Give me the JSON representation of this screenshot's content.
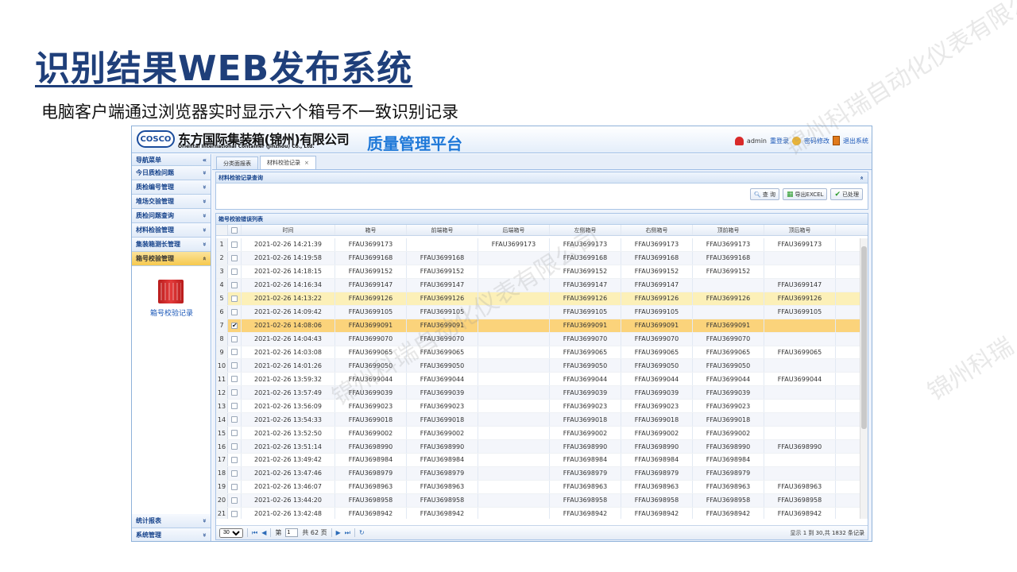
{
  "slide": {
    "title": "识别结果WEB发布系统",
    "subtitle": "电脑客户端通过浏览器实时显示六个箱号不一致识别记录",
    "watermarks": [
      "锦州科瑞自动化仪表有限公司",
      "锦州科瑞"
    ]
  },
  "app": {
    "logo": "COSCO",
    "company_cn": "东方国际集装箱(锦州)有限公司",
    "company_en": "Oriental International Container (Jinzhou) Co., Ltd.",
    "platform": "质量管理平台",
    "user": {
      "name": "admin",
      "relogin": "重登录",
      "change_password": "密码修改",
      "logout": "退出系统"
    },
    "sidebar": {
      "header": "导航菜单",
      "collapse_glyph": "«",
      "items": [
        {
          "label": "今日质检问题",
          "glyph": "»"
        },
        {
          "label": "质检编号管理",
          "glyph": "»"
        },
        {
          "label": "堆场交验管理",
          "glyph": "»"
        },
        {
          "label": "质检问题查询",
          "glyph": "»"
        },
        {
          "label": "材料检验管理",
          "glyph": "»"
        },
        {
          "label": "集装箱测长管理",
          "glyph": "»"
        },
        {
          "label": "箱号校验管理",
          "glyph": "«"
        }
      ],
      "panel_item": "箱号校验记录",
      "bottom_items": [
        {
          "label": "统计报表",
          "glyph": "»"
        },
        {
          "label": "系统管理",
          "glyph": "»"
        }
      ]
    },
    "tabs": [
      {
        "label": "分类面报表"
      },
      {
        "label": "材料校验记录",
        "close": "×"
      }
    ],
    "query_panel": {
      "title": "材料检验记录查询",
      "collapse_glyph": "«",
      "buttons": {
        "query": "查 询",
        "export": "导出EXCEL",
        "processed": "已处理"
      }
    },
    "grid": {
      "title": "箱号校验错误列表",
      "columns": [
        "时间",
        "箱号",
        "前端箱号",
        "后端箱号",
        "左侧箱号",
        "右侧箱号",
        "顶前箱号",
        "顶后箱号"
      ],
      "rows": [
        {
          "n": "1",
          "checked": false,
          "time": "2021-02-26 14:21:39",
          "no": "FFAU3699173",
          "front": "",
          "rear": "FFAU3699173",
          "left": "FFAU3699173",
          "right": "FFAU3699173",
          "top": "FFAU3699173",
          "topr": "FFAU3699173"
        },
        {
          "n": "2",
          "checked": false,
          "time": "2021-02-26 14:19:58",
          "no": "FFAU3699168",
          "front": "FFAU3699168",
          "rear": "",
          "left": "FFAU3699168",
          "right": "FFAU3699168",
          "top": "FFAU3699168",
          "topr": ""
        },
        {
          "n": "3",
          "checked": false,
          "time": "2021-02-26 14:18:15",
          "no": "FFAU3699152",
          "front": "FFAU3699152",
          "rear": "",
          "left": "FFAU3699152",
          "right": "FFAU3699152",
          "top": "FFAU3699152",
          "topr": ""
        },
        {
          "n": "4",
          "checked": false,
          "time": "2021-02-26 14:16:34",
          "no": "FFAU3699147",
          "front": "FFAU3699147",
          "rear": "",
          "left": "FFAU3699147",
          "right": "FFAU3699147",
          "top": "",
          "topr": "FFAU3699147"
        },
        {
          "n": "5",
          "checked": false,
          "time": "2021-02-26 14:13:22",
          "no": "FFAU3699126",
          "front": "FFAU3699126",
          "rear": "",
          "left": "FFAU3699126",
          "right": "FFAU3699126",
          "top": "FFAU3699126",
          "topr": "FFAU3699126"
        },
        {
          "n": "6",
          "checked": false,
          "time": "2021-02-26 14:09:42",
          "no": "FFAU3699105",
          "front": "FFAU3699105",
          "rear": "",
          "left": "FFAU3699105",
          "right": "FFAU3699105",
          "top": "",
          "topr": "FFAU3699105"
        },
        {
          "n": "7",
          "checked": true,
          "time": "2021-02-26 14:08:06",
          "no": "FFAU3699091",
          "front": "FFAU3699091",
          "rear": "",
          "left": "FFAU3699091",
          "right": "FFAU3699091",
          "top": "FFAU3699091",
          "topr": ""
        },
        {
          "n": "8",
          "checked": false,
          "time": "2021-02-26 14:04:43",
          "no": "FFAU3699070",
          "front": "FFAU3699070",
          "rear": "",
          "left": "FFAU3699070",
          "right": "FFAU3699070",
          "top": "FFAU3699070",
          "topr": ""
        },
        {
          "n": "9",
          "checked": false,
          "time": "2021-02-26 14:03:08",
          "no": "FFAU3699065",
          "front": "FFAU3699065",
          "rear": "",
          "left": "FFAU3699065",
          "right": "FFAU3699065",
          "top": "FFAU3699065",
          "topr": "FFAU3699065"
        },
        {
          "n": "10",
          "checked": false,
          "time": "2021-02-26 14:01:26",
          "no": "FFAU3699050",
          "front": "FFAU3699050",
          "rear": "",
          "left": "FFAU3699050",
          "right": "FFAU3699050",
          "top": "FFAU3699050",
          "topr": ""
        },
        {
          "n": "11",
          "checked": false,
          "time": "2021-02-26 13:59:32",
          "no": "FFAU3699044",
          "front": "FFAU3699044",
          "rear": "",
          "left": "FFAU3699044",
          "right": "FFAU3699044",
          "top": "FFAU3699044",
          "topr": "FFAU3699044"
        },
        {
          "n": "12",
          "checked": false,
          "time": "2021-02-26 13:57:49",
          "no": "FFAU3699039",
          "front": "FFAU3699039",
          "rear": "",
          "left": "FFAU3699039",
          "right": "FFAU3699039",
          "top": "FFAU3699039",
          "topr": ""
        },
        {
          "n": "13",
          "checked": false,
          "time": "2021-02-26 13:56:09",
          "no": "FFAU3699023",
          "front": "FFAU3699023",
          "rear": "",
          "left": "FFAU3699023",
          "right": "FFAU3699023",
          "top": "FFAU3699023",
          "topr": ""
        },
        {
          "n": "14",
          "checked": false,
          "time": "2021-02-26 13:54:33",
          "no": "FFAU3699018",
          "front": "FFAU3699018",
          "rear": "",
          "left": "FFAU3699018",
          "right": "FFAU3699018",
          "top": "FFAU3699018",
          "topr": ""
        },
        {
          "n": "15",
          "checked": false,
          "time": "2021-02-26 13:52:50",
          "no": "FFAU3699002",
          "front": "FFAU3699002",
          "rear": "",
          "left": "FFAU3699002",
          "right": "FFAU3699002",
          "top": "FFAU3699002",
          "topr": ""
        },
        {
          "n": "16",
          "checked": false,
          "time": "2021-02-26 13:51:14",
          "no": "FFAU3698990",
          "front": "FFAU3698990",
          "rear": "",
          "left": "FFAU3698990",
          "right": "FFAU3698990",
          "top": "FFAU3698990",
          "topr": "FFAU3698990"
        },
        {
          "n": "17",
          "checked": false,
          "time": "2021-02-26 13:49:42",
          "no": "FFAU3698984",
          "front": "FFAU3698984",
          "rear": "",
          "left": "FFAU3698984",
          "right": "FFAU3698984",
          "top": "FFAU3698984",
          "topr": ""
        },
        {
          "n": "18",
          "checked": false,
          "time": "2021-02-26 13:47:46",
          "no": "FFAU3698979",
          "front": "FFAU3698979",
          "rear": "",
          "left": "FFAU3698979",
          "right": "FFAU3698979",
          "top": "FFAU3698979",
          "topr": ""
        },
        {
          "n": "19",
          "checked": false,
          "time": "2021-02-26 13:46:07",
          "no": "FFAU3698963",
          "front": "FFAU3698963",
          "rear": "",
          "left": "FFAU3698963",
          "right": "FFAU3698963",
          "top": "FFAU3698963",
          "topr": "FFAU3698963"
        },
        {
          "n": "20",
          "checked": false,
          "time": "2021-02-26 13:44:20",
          "no": "FFAU3698958",
          "front": "FFAU3698958",
          "rear": "",
          "left": "FFAU3698958",
          "right": "FFAU3698958",
          "top": "FFAU3698958",
          "topr": "FFAU3698958"
        },
        {
          "n": "21",
          "checked": false,
          "time": "2021-02-26 13:42:48",
          "no": "FFAU3698942",
          "front": "FFAU3698942",
          "rear": "",
          "left": "FFAU3698942",
          "right": "FFAU3698942",
          "top": "FFAU3698942",
          "topr": "FFAU3698942"
        }
      ],
      "highlight_row": "5",
      "selected_row": "7"
    },
    "pager": {
      "page_size": "30",
      "page_prefix": "第",
      "current_page": "1",
      "total_pages": "共 62 页",
      "info": "显示 1 到 30,共 1832 条记录"
    }
  }
}
